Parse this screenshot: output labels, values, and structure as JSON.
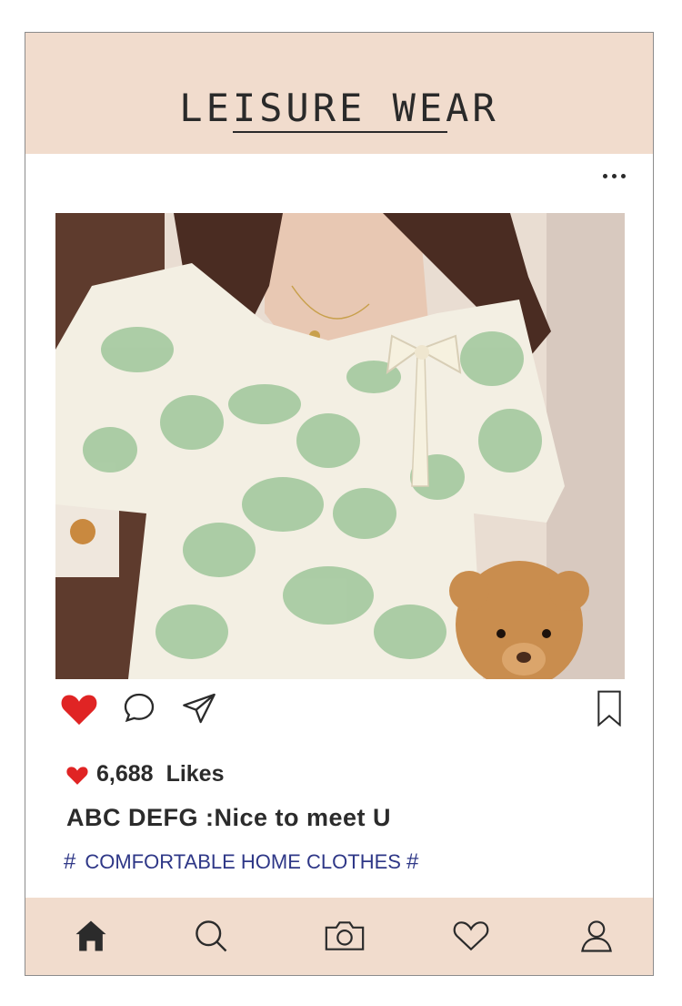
{
  "header": {
    "title": "LEISURE WEAR"
  },
  "post": {
    "image_alt": "woman wearing green floral puff-sleeve top holding a teddy bear",
    "likes_count": "6,688",
    "likes_label": "Likes",
    "caption": "ABC DEFG :Nice to meet U",
    "hashtag_start": "#",
    "hashtag_text": "COMFORTABLE HOME CLOTHES",
    "hashtag_end": "#"
  },
  "icons": {
    "like": "heart-icon",
    "comment": "comment-icon",
    "share": "send-icon",
    "save": "bookmark-icon",
    "more": "more-icon"
  },
  "bottom_nav": [
    "home-icon",
    "search-icon",
    "camera-icon",
    "heart-icon",
    "profile-icon"
  ],
  "colors": {
    "accent_band": "#f1dccd",
    "like_red": "#e02424",
    "hashtag_blue": "#2e3787",
    "text_dark": "#2b2b2b"
  }
}
